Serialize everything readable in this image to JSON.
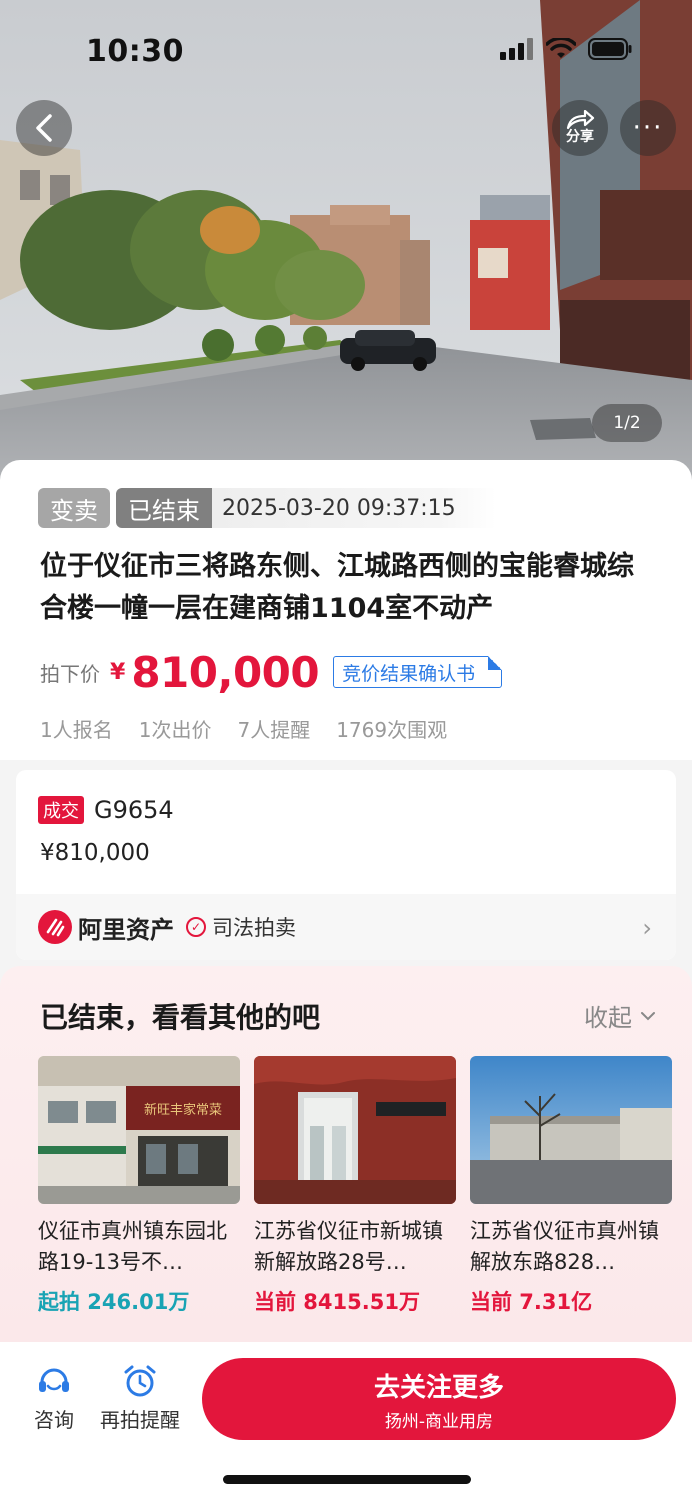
{
  "status_bar": {
    "time": "10:30"
  },
  "hero": {
    "share_label": "分享",
    "more_label": "···",
    "image_counter": "1/2"
  },
  "auction": {
    "tag_type": "变卖",
    "tag_status": "已结束",
    "end_time": "2025-03-20 09:37:15",
    "title": "位于仪征市三将路东侧、江城路西侧的宝能睿城综合楼一幢一层在建商铺1104室不动产",
    "price_label": "拍下价",
    "price_currency": "¥",
    "price_value": "810,000",
    "confirm_link": "竞价结果确认书",
    "stats": {
      "signups": "1人报名",
      "bids": "1次出价",
      "reminders": "7人提醒",
      "views": "1769次围观"
    }
  },
  "deal": {
    "badge": "成交",
    "code": "G9654",
    "price": "¥810,000",
    "platform_name": "阿里资产",
    "judicial_label": "司法拍卖"
  },
  "recommend": {
    "title": "已结束，看看其他的吧",
    "collapse_label": "收起",
    "items": [
      {
        "name": "仪征市真州镇东园北路19-13号不…",
        "price": "起拍 246.01万",
        "signboard": "新旺丰家常菜"
      },
      {
        "name": "江苏省仪征市新城镇新解放路28号…",
        "price": "当前 8415.51万"
      },
      {
        "name": "江苏省仪征市真州镇解放东路828…",
        "price": "当前 7.31亿"
      }
    ]
  },
  "bottom_bar": {
    "consult_label": "咨询",
    "remind_label": "再拍提醒",
    "follow_main": "去关注更多",
    "follow_sub": "扬州-商业用房"
  },
  "colors": {
    "accent_red": "#e3163c",
    "link_blue": "#2c7be5",
    "teal": "#19a3b4"
  }
}
